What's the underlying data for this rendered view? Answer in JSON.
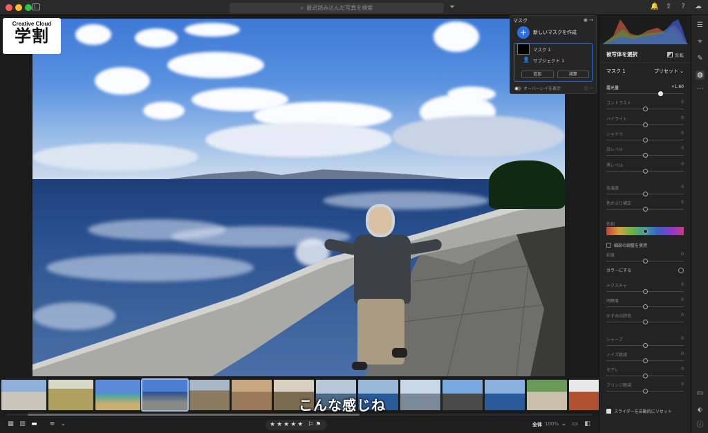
{
  "titlebar": {
    "search_placeholder": "最近読み込んだ写真を検索"
  },
  "badge": {
    "line1": "Creative Cloud",
    "line2": "学割"
  },
  "mask_popup": {
    "title": "マスク",
    "create_label": "新しいマスクを作成",
    "items": [
      {
        "label": "マスク 1"
      },
      {
        "label": "サブジェクト 1"
      }
    ],
    "add_label": "追加",
    "subtract_label": "減算",
    "overlay_label": "オーバーレイを表示"
  },
  "panel": {
    "subject_title": "被写体を選択",
    "invert_label": "反転",
    "mask_name": "マスク 1",
    "preset_label": "プリセット",
    "sliders": [
      {
        "label": "露光量",
        "value": "+1.60",
        "pos": 0.7,
        "active": true
      },
      {
        "label": "コントラスト",
        "value": "0",
        "pos": 0.5
      },
      {
        "label": "ハイライト",
        "value": "0",
        "pos": 0.5
      },
      {
        "label": "シャドウ",
        "value": "0",
        "pos": 0.5
      },
      {
        "label": "白レベル",
        "value": "0",
        "pos": 0.5
      },
      {
        "label": "黒レベル",
        "value": "0",
        "pos": 0.5
      },
      {
        "label": "色温度",
        "value": "0",
        "pos": 0.5
      },
      {
        "label": "色かぶり補正",
        "value": "0",
        "pos": 0.5
      }
    ],
    "hue_label": "色相",
    "fine_adjust_label": "細部の調整を使用",
    "saturation_label": "彩度",
    "saturation_value": "0",
    "color_label": "カラーにする",
    "sliders2": [
      {
        "label": "テクスチャ",
        "value": "0",
        "pos": 0.5
      },
      {
        "label": "明瞭度",
        "value": "0",
        "pos": 0.5
      },
      {
        "label": "かすみの除去",
        "value": "0",
        "pos": 0.5
      },
      {
        "label": "シャープ",
        "value": "0",
        "pos": 0.5
      },
      {
        "label": "ノイズ軽減",
        "value": "0",
        "pos": 0.5
      },
      {
        "label": "モアレ",
        "value": "0",
        "pos": 0.5
      },
      {
        "label": "フリンジ軽減",
        "value": "0",
        "pos": 0.5
      }
    ],
    "auto_reset_label": "スライダーを自動的にリセット"
  },
  "subtitle": "こんな感じね",
  "bottombar": {
    "stars": "★★★★★",
    "zoom_label": "全体",
    "zoom_value": "100%"
  }
}
